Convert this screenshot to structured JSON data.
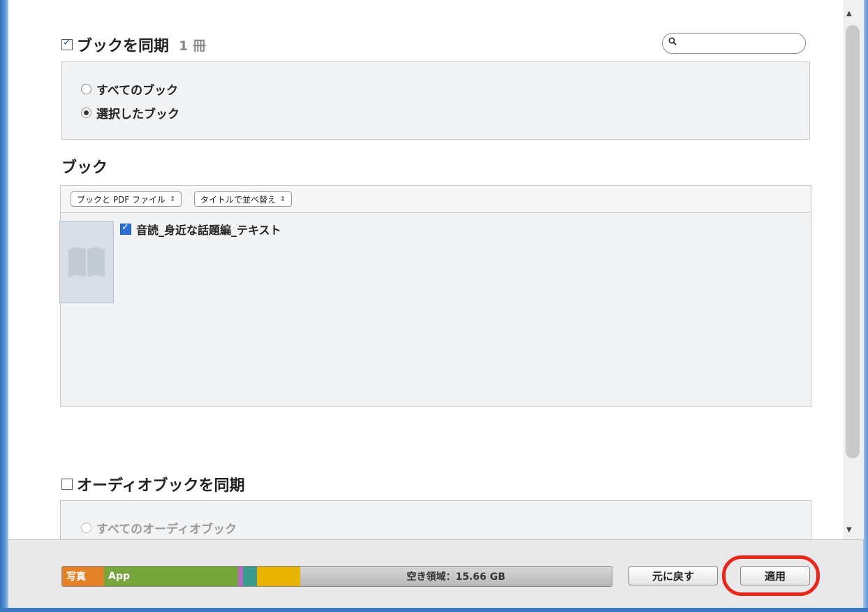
{
  "books_section": {
    "title": "ブックを同期",
    "count": "1 冊",
    "checked": true,
    "search_placeholder": "",
    "options": [
      {
        "label": "すべてのブック",
        "selected": false
      },
      {
        "label": "選択したブック",
        "selected": true
      }
    ]
  },
  "books_list": {
    "heading": "ブック",
    "filter_popup": "ブックと PDF ファイル",
    "sort_popup": "タイトルで並べ替え",
    "items": [
      {
        "title": "音読_身近な話題編_テキスト",
        "checked": true,
        "cover_icon": "book-cover-icon"
      }
    ]
  },
  "audiobooks_section": {
    "title": "オーディオブックを同期",
    "checked": false,
    "options": [
      {
        "label": "すべてのオーディオブック",
        "selected": false
      }
    ]
  },
  "capacity_bar": {
    "segments": [
      {
        "label": "写真",
        "color": "#e4822a"
      },
      {
        "label": "App",
        "color": "#76a63c"
      },
      {
        "label": "",
        "color": "#b06cc2"
      },
      {
        "label": "",
        "color": "#3a9a8c"
      },
      {
        "label": "",
        "color": "#e8b400"
      }
    ],
    "free_label": "空き領域：15.66 GB"
  },
  "buttons": {
    "revert": "元に戻す",
    "apply": "適用"
  },
  "colors": {
    "accent": "#2a6fd6",
    "highlight": "#e8261a"
  }
}
